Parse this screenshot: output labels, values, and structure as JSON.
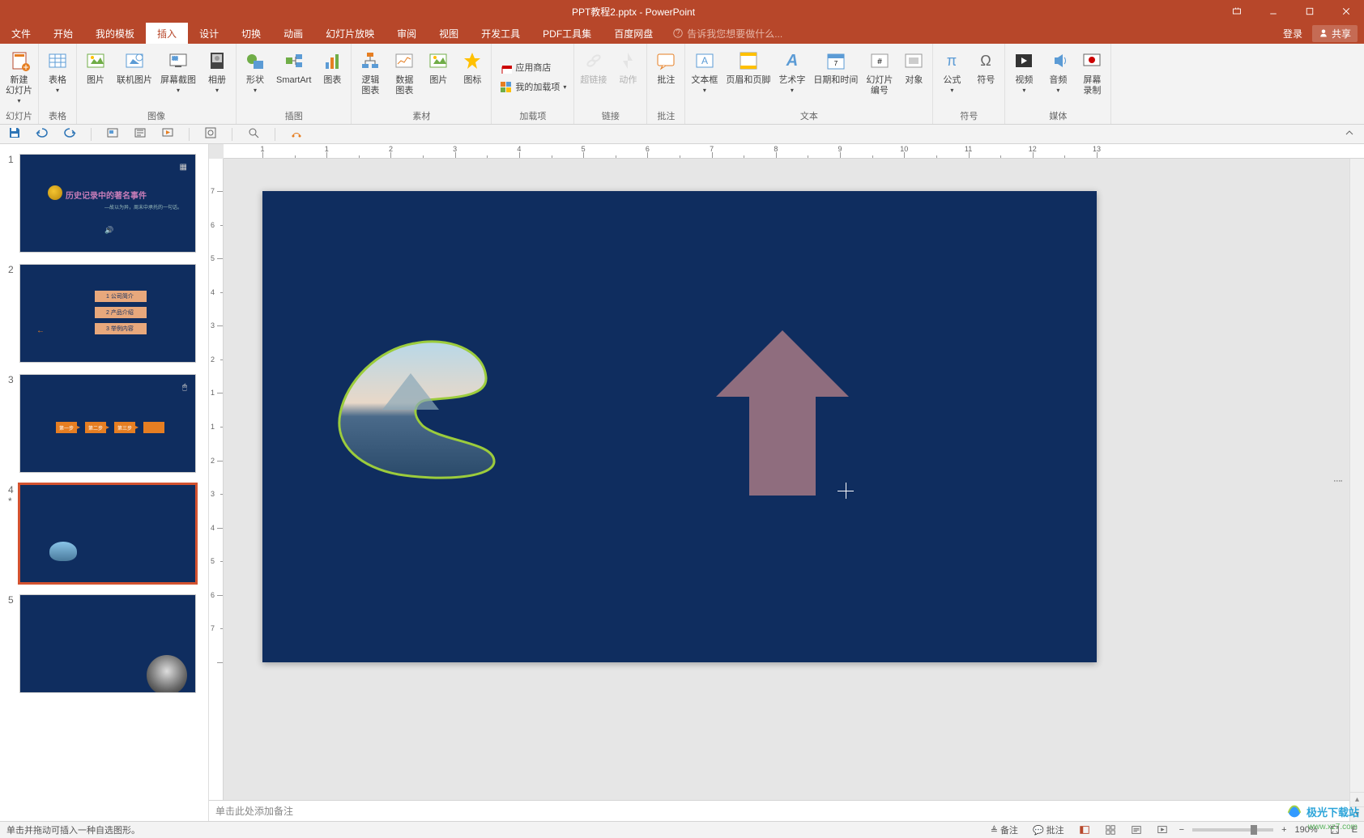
{
  "title_bar": {
    "doc_title": "PPT教程2.pptx - PowerPoint"
  },
  "menu": {
    "tabs": [
      "文件",
      "开始",
      "我的模板",
      "插入",
      "设计",
      "切换",
      "动画",
      "幻灯片放映",
      "审阅",
      "视图",
      "开发工具",
      "PDF工具集",
      "百度网盘"
    ],
    "active_index": 3,
    "tell_me": "告诉我您想要做什么...",
    "login": "登录",
    "share": "共享"
  },
  "ribbon": {
    "groups": [
      {
        "label": "幻灯片",
        "items": [
          {
            "name": "new-slide",
            "text": "新建\n幻灯片",
            "dd": true,
            "svg": "slide"
          }
        ]
      },
      {
        "label": "表格",
        "items": [
          {
            "name": "table",
            "text": "表格",
            "dd": true,
            "svg": "table"
          }
        ]
      },
      {
        "label": "图像",
        "items": [
          {
            "name": "picture",
            "text": "图片",
            "svg": "pic"
          },
          {
            "name": "online-picture",
            "text": "联机图片",
            "svg": "pic2"
          },
          {
            "name": "screenshot",
            "text": "屏幕截图",
            "dd": true,
            "svg": "screen"
          },
          {
            "name": "album",
            "text": "相册",
            "dd": true,
            "svg": "album"
          }
        ]
      },
      {
        "label": "插图",
        "items": [
          {
            "name": "shapes",
            "text": "形状",
            "dd": true,
            "svg": "shapes"
          },
          {
            "name": "smartart",
            "text": "SmartArt",
            "svg": "smartart"
          },
          {
            "name": "chart",
            "text": "图表",
            "svg": "chart"
          }
        ]
      },
      {
        "label": "素材",
        "items": [
          {
            "name": "logic-chart",
            "text": "逻辑\n图表",
            "svg": "lchart"
          },
          {
            "name": "data-chart",
            "text": "数据\n图表",
            "svg": "dchart"
          },
          {
            "name": "image",
            "text": "图片",
            "svg": "pic"
          },
          {
            "name": "icon",
            "text": "图标",
            "svg": "icon"
          }
        ]
      },
      {
        "label": "加载项",
        "stack": true,
        "items": [
          {
            "name": "store",
            "text": "应用商店",
            "svg": "store",
            "small": true
          },
          {
            "name": "my-addins",
            "text": "我的加载项",
            "svg": "addin",
            "small": true,
            "dd": true
          }
        ]
      },
      {
        "label": "链接",
        "items": [
          {
            "name": "hyperlink",
            "text": "超链接",
            "svg": "link",
            "disabled": true
          },
          {
            "name": "action",
            "text": "动作",
            "svg": "action",
            "disabled": true
          }
        ]
      },
      {
        "label": "批注",
        "items": [
          {
            "name": "comment",
            "text": "批注",
            "svg": "comment"
          }
        ]
      },
      {
        "label": "文本",
        "items": [
          {
            "name": "textbox",
            "text": "文本框",
            "dd": true,
            "svg": "textbox"
          },
          {
            "name": "header-footer",
            "text": "页眉和页脚",
            "svg": "hf"
          },
          {
            "name": "wordart",
            "text": "艺术字",
            "dd": true,
            "svg": "wordart"
          },
          {
            "name": "datetime",
            "text": "日期和时间",
            "svg": "date"
          },
          {
            "name": "slide-number",
            "text": "幻灯片\n编号",
            "svg": "num"
          },
          {
            "name": "object",
            "text": "对象",
            "svg": "obj"
          }
        ]
      },
      {
        "label": "符号",
        "items": [
          {
            "name": "equation",
            "text": "公式",
            "dd": true,
            "svg": "eq"
          },
          {
            "name": "symbol",
            "text": "符号",
            "svg": "sym"
          }
        ]
      },
      {
        "label": "媒体",
        "items": [
          {
            "name": "video",
            "text": "视频",
            "dd": true,
            "svg": "video"
          },
          {
            "name": "audio",
            "text": "音频",
            "dd": true,
            "svg": "audio"
          },
          {
            "name": "screen-record",
            "text": "屏幕\n录制",
            "svg": "rec"
          }
        ]
      }
    ]
  },
  "thumbnails": {
    "slides": [
      {
        "n": "1",
        "type": "title",
        "title": "历史记录中的著名事件"
      },
      {
        "n": "2",
        "type": "list",
        "items": [
          "公司简介",
          "产品介绍",
          "举例内容"
        ]
      },
      {
        "n": "3",
        "type": "process",
        "steps": [
          "第一步",
          "第二步",
          "第三步",
          ""
        ]
      },
      {
        "n": "4",
        "type": "current",
        "selected": true,
        "asterisk": "*"
      },
      {
        "n": "5",
        "type": "einstein"
      }
    ]
  },
  "notes_placeholder": "单击此处添加备注",
  "status": {
    "hint": "单击并拖动可插入一种自选图形。",
    "notes_btn": "备注",
    "comments_btn": "批注",
    "zoom": "190%",
    "lang": "E"
  },
  "ruler_h_labels": [
    "1",
    "1",
    "2",
    "3",
    "4",
    "5",
    "6",
    "7",
    "8",
    "9",
    "10",
    "11",
    "12",
    "13"
  ],
  "ruler_v_labels": [
    "7",
    "6",
    "5",
    "4",
    "3",
    "2",
    "1",
    "1",
    "2",
    "3",
    "4",
    "5",
    "6",
    "7"
  ],
  "watermark": {
    "text": "极光下载站",
    "url": "www.xz7.com"
  }
}
